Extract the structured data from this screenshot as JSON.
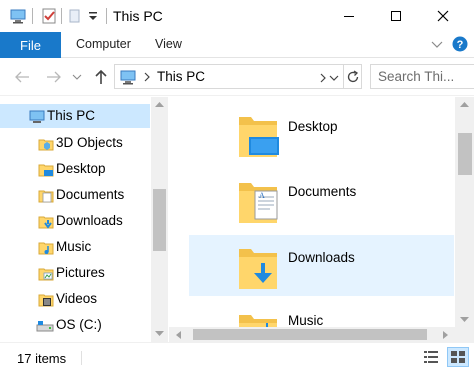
{
  "window": {
    "title": "This PC"
  },
  "ribbon": {
    "tabs": [
      "File",
      "Computer",
      "View"
    ]
  },
  "address": {
    "path": "This PC",
    "search_placeholder": "Search Thi..."
  },
  "navpane": {
    "items": [
      {
        "label": "This PC",
        "icon": "pc-icon"
      },
      {
        "label": "3D Objects",
        "icon": "3d-objects-icon"
      },
      {
        "label": "Desktop",
        "icon": "desktop-folder-icon"
      },
      {
        "label": "Documents",
        "icon": "documents-folder-icon"
      },
      {
        "label": "Downloads",
        "icon": "downloads-folder-icon"
      },
      {
        "label": "Music",
        "icon": "music-folder-icon"
      },
      {
        "label": "Pictures",
        "icon": "pictures-folder-icon"
      },
      {
        "label": "Videos",
        "icon": "videos-folder-icon"
      },
      {
        "label": "OS (C:)",
        "icon": "drive-icon"
      }
    ]
  },
  "content": {
    "folders": [
      {
        "name": "Desktop",
        "icon": "desktop-folder-icon"
      },
      {
        "name": "Documents",
        "icon": "documents-folder-icon"
      },
      {
        "name": "Downloads",
        "icon": "downloads-folder-icon",
        "selected": true
      },
      {
        "name": "Music",
        "icon": "music-folder-icon"
      }
    ]
  },
  "status": {
    "item_count": "17 items"
  },
  "colors": {
    "accent": "#1979ca",
    "selection": "#cce8ff",
    "hover": "#e5f3ff",
    "folder": "#ffd66b"
  }
}
